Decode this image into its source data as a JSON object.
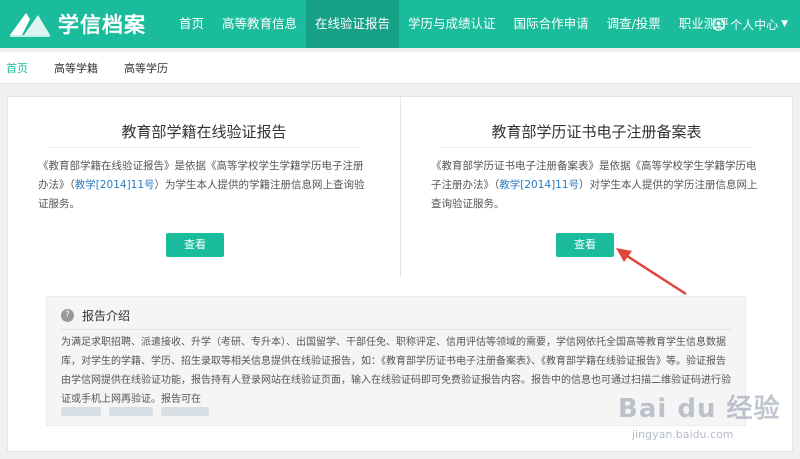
{
  "header": {
    "brand": "学信档案",
    "nav": [
      "首页",
      "高等教育信息",
      "在线验证报告",
      "学历与成绩认证",
      "国际合作申请",
      "调查/投票",
      "职业测评"
    ],
    "active_nav_index": 2,
    "user_menu": "个人中心"
  },
  "breadcrumb": [
    "首页",
    "高等学籍",
    "高等学历"
  ],
  "cards": {
    "left": {
      "title": "教育部学籍在线验证报告",
      "desc_pre": "《教育部学籍在线验证报告》是依据《高等学校学生学籍学历电子注册办法》（",
      "desc_link": "教学[2014]11号",
      "desc_post": "）为学生本人提供的学籍注册信息网上查询验证服务。",
      "button": "查看"
    },
    "right": {
      "title": "教育部学历证书电子注册备案表",
      "desc_pre": "《教育部学历证书电子注册备案表》是依据《高等学校学生学籍学历电子注册办法》（",
      "desc_link": "教学[2014]11号",
      "desc_post": "）对学生本人提供的学历注册信息网上查询验证服务。",
      "button": "查看"
    }
  },
  "intro": {
    "title": "报告介绍",
    "text": "为满足求职招聘、派遣接收、升学（考研、专升本）、出国留学、干部任免、职称评定、信用评估等领域的需要，学信网依托全国高等教育学生信息数据库，对学生的学籍、学历、招生录取等相关信息提供在线验证报告，如：《教育部学历证书电子注册备案表》、《教育部学籍在线验证报告》等。验证报告由学信网提供在线验证功能，报告持有人登录网站在线验证页面，输入在线验证码即可免费验证报告内容。报告中的信息也可通过扫描二维验证码进行验证或手机上网再验证。报告可在"
  },
  "watermark": {
    "big": "Bai du 经验",
    "small": "jingyan.baidu.com"
  },
  "colors": {
    "primary": "#1abc9c",
    "primary_dark": "#16a085",
    "link": "#2a7bc0",
    "arrow": "#e0443a"
  }
}
